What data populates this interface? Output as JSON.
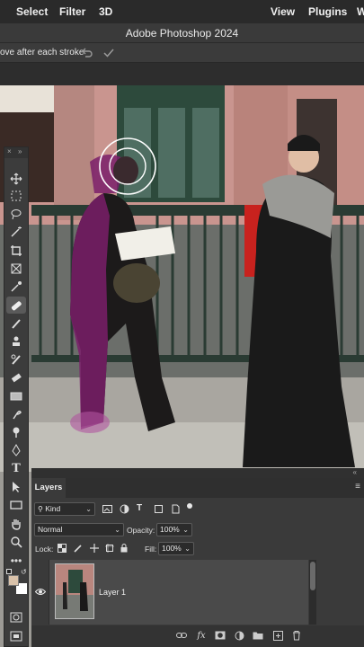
{
  "menu": {
    "items": [
      "Select",
      "Filter",
      "3D",
      "View",
      "Plugins",
      "W"
    ]
  },
  "window": {
    "title": "Adobe Photoshop 2024"
  },
  "options_bar": {
    "label": "ove after each stroke"
  },
  "layers_panel": {
    "tab_label": "Layers",
    "kind_label": "Kind",
    "blend_mode": "Normal",
    "opacity_label": "Opacity:",
    "opacity_value": "100%",
    "lock_label": "Lock:",
    "fill_label": "Fill:",
    "fill_value": "100%",
    "layers": [
      {
        "name": "Layer 1",
        "visible": true
      }
    ],
    "footer_icons": [
      "link-icon",
      "fx-icon",
      "mask-icon",
      "adjustment-icon",
      "folder-icon",
      "new-layer-icon",
      "trash-icon"
    ]
  },
  "colors": {
    "foreground": "#1a1a1a",
    "background": "#d9c2aa",
    "selection_overlay": "#7a1f6a"
  }
}
